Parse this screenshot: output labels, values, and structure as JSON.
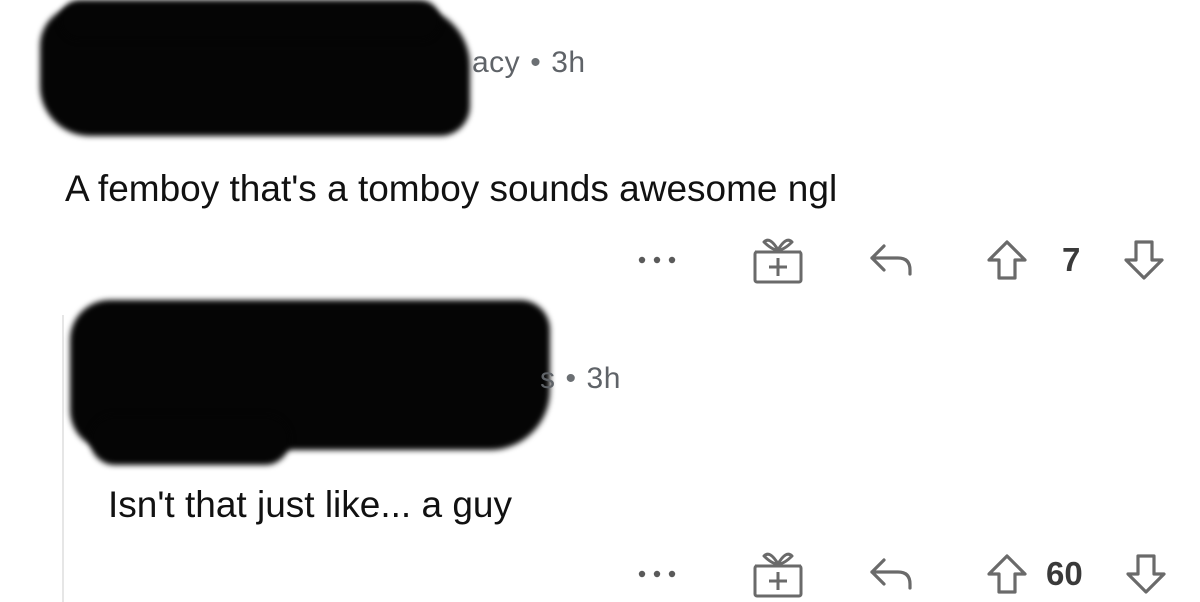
{
  "comments": [
    {
      "username_visible_fragment": "acy",
      "separator": "•",
      "age": "3h",
      "body": "A femboy that's a tomboy sounds awesome ngl",
      "more_label": "...",
      "vote_count": "7"
    },
    {
      "username_visible_fragment": "s",
      "separator": "•",
      "age": "3h",
      "body": "Isn't that just like... a guy",
      "more_label": "...",
      "vote_count": "60"
    }
  ],
  "icons": {
    "more": "more-icon",
    "award": "gift-award-icon",
    "reply": "reply-icon",
    "upvote": "upvote-arrow-icon",
    "downvote": "downvote-arrow-icon"
  },
  "colors": {
    "text": "#111111",
    "meta": "#5f6368",
    "icon": "#6f6f6f",
    "redaction": "#050505",
    "thread_line": "#e6e6e6"
  }
}
